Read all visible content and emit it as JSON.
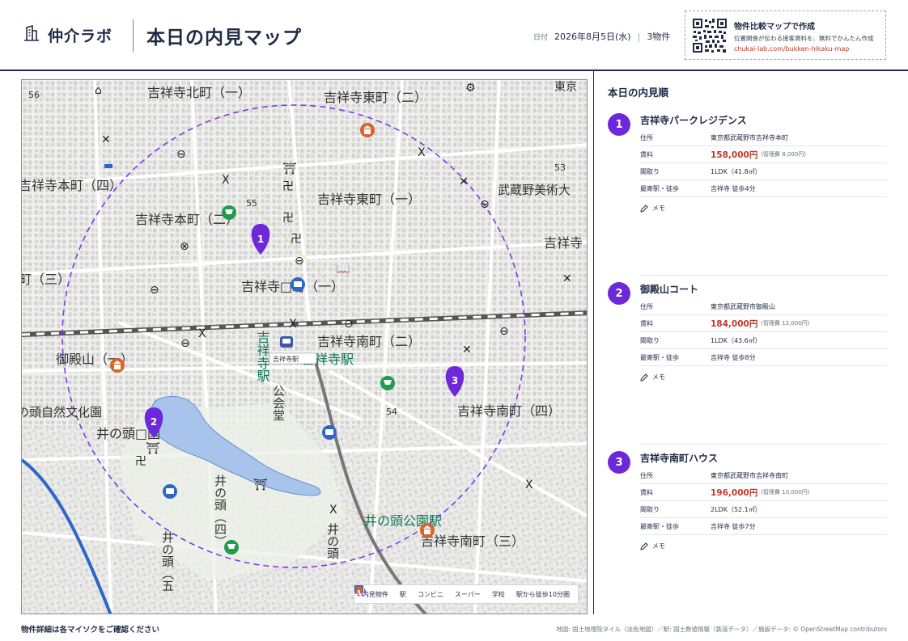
{
  "brand": {
    "name": "仲介ラボ",
    "icon": "building-icon"
  },
  "page_title": "本日の内見マップ",
  "meta": {
    "date_label": "日付",
    "date": "2026年8月5日(水)",
    "separator": "|",
    "count": "3物件"
  },
  "promo": {
    "title": "物件比較マップで作成",
    "subtitle": "位置関係が伝わる接客資料を、無料でかんたん作成",
    "url": "chukai-lab.com/bukken-hikaku-map",
    "url_color": "#c0392b"
  },
  "colors": {
    "accent": "#6d28d9",
    "navy": "#1f2a44",
    "price": "#c0392b",
    "water": "#a8c4ec",
    "walk_circle": "#7c3aed"
  },
  "map": {
    "labels": {
      "kitamachi1": "吉祥寺北町（一）",
      "higashicho2": "吉祥寺東町（二）",
      "tokyo": "東京",
      "n56": "56",
      "honcho4": "吉祥寺本町（四）",
      "n55": "55",
      "higashicho1": "吉祥寺東町（一）",
      "musabi": "武蔵野美術大",
      "n53": "53",
      "honcho2": "吉祥寺本町（二）",
      "kichijoji_r": "吉祥寺",
      "machi3": "町（三）",
      "honcho1": "吉祥寺□町（一）",
      "minami2": "吉祥寺南町（二）",
      "goten1": "御殿山（一）",
      "station_v": "吉祥寺駅",
      "station_h": "吉祥寺駅",
      "station_small": "吉祥寺駅",
      "park_shizen": "の頭自然文化園",
      "inokashira_park": "井の頭□園",
      "kokaido": "公会堂",
      "n54": "54",
      "minami4": "吉祥寺南町（四）",
      "inokashira_v1": "井の頭（四）",
      "inokashira_v2": "井の頭",
      "inokashira_v3": "井の頭（五",
      "inokoen_st": "井の頭公園駅",
      "minami3": "吉祥寺南町（三）"
    },
    "pins": [
      {
        "num": "1",
        "name": "吉祥寺パークレジデンス"
      },
      {
        "num": "2",
        "name": "御殿山コート"
      },
      {
        "num": "3",
        "name": "吉祥寺南町ハウス"
      }
    ]
  },
  "legend": {
    "items": [
      {
        "icon": "pin-icon",
        "label": "内見物件"
      },
      {
        "icon": "train-icon",
        "label": "駅"
      },
      {
        "icon": "convenience-store-icon",
        "label": "コンビニ"
      },
      {
        "icon": "cart-icon",
        "label": "スーパー"
      },
      {
        "icon": "school-icon",
        "label": "学校"
      },
      {
        "icon": "dashed-circle-icon",
        "label": "駅から徒歩10分圏"
      }
    ]
  },
  "panel": {
    "title": "本日の内見順",
    "labels": {
      "address": "住所",
      "rent": "賃料",
      "layout": "間取り",
      "station": "最寄駅・徒歩",
      "memo": "メモ"
    },
    "properties": [
      {
        "num": "1",
        "name": "吉祥寺パークレジデンス",
        "address": "東京都武蔵野市吉祥寺本町",
        "rent": "158,000円",
        "fee": "(管理費 8,000円)",
        "layout": "1LDK（41.8㎡）",
        "station": "吉祥寺 徒歩4分"
      },
      {
        "num": "2",
        "name": "御殿山コート",
        "address": "東京都武蔵野市御殿山",
        "rent": "184,000円",
        "fee": "(管理費 12,000円)",
        "layout": "1LDK（43.6㎡）",
        "station": "吉祥寺 徒歩8分"
      },
      {
        "num": "3",
        "name": "吉祥寺南町ハウス",
        "address": "東京都武蔵野市吉祥寺南町",
        "rent": "196,000円",
        "fee": "(管理費 10,000円)",
        "layout": "2LDK（52.1㎡）",
        "station": "吉祥寺 徒歩7分"
      }
    ]
  },
  "footer": {
    "note": "物件詳細は各マイソクをご確認ください",
    "credit": "地図: 国土地理院タイル（淡色地図）／駅: 国土数値情報（鉄道データ）／施設データ: © OpenStreetMap contributors"
  }
}
